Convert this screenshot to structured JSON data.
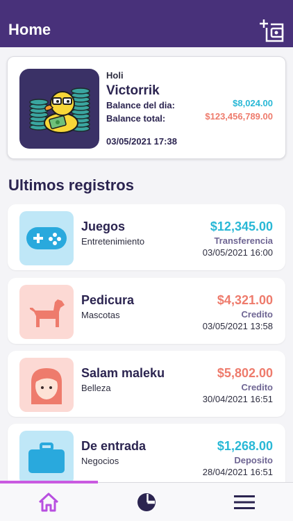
{
  "header": {
    "title": "Home"
  },
  "profile": {
    "greeting": "Holi",
    "name": "Victorrik",
    "balance_day_label": "Balance del dia:",
    "balance_day_value": "$8,024.00",
    "balance_total_label": "Balance total:",
    "balance_total_value": "$123,456,789.00",
    "datetime": "03/05/2021 17:38"
  },
  "section_title": "Ultimos registros",
  "records": [
    {
      "name": "Juegos",
      "category": "Entretenimiento",
      "amount": "$12,345.00",
      "type": "Transferencia",
      "date": "03/05/2021 16:00",
      "icon": "gamepad-icon"
    },
    {
      "name": "Pedicura",
      "category": "Mascotas",
      "amount": "$4,321.00",
      "type": "Credito",
      "date": "03/05/2021 13:58",
      "icon": "dog-icon"
    },
    {
      "name": "Salam maleku",
      "category": "Belleza",
      "amount": "$5,802.00",
      "type": "Credito",
      "date": "30/04/2021 16:51",
      "icon": "woman-face-icon"
    },
    {
      "name": "De entrada",
      "category": "Negocios",
      "amount": "$1,268.00",
      "type": "Deposito",
      "date": "28/04/2021 16:51",
      "icon": "briefcase-icon"
    }
  ],
  "tabs": [
    "home-icon",
    "pie-chart-icon",
    "menu-icon"
  ],
  "colors": {
    "header": "#48317a",
    "positive": "#29b8d6",
    "negative": "#ee7b6c",
    "tab_active": "#c95ae0",
    "text_primary": "#2b2450"
  }
}
